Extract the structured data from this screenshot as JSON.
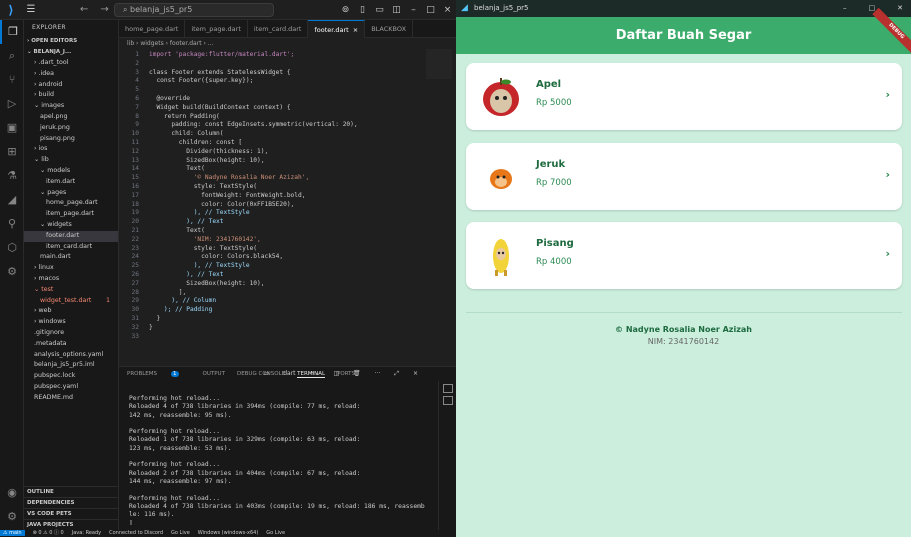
{
  "window": {
    "title": "belanja_js5_pr5"
  },
  "activity": [
    "explorer-icon",
    "search-icon",
    "source-control-icon",
    "run-debug-icon",
    "remote-icon",
    "extensions-icon",
    "testing-icon",
    "flutter-icon",
    "test-icon",
    "deploy-icon",
    "settings-icon"
  ],
  "explorer": {
    "header": "EXPLORER",
    "open_editors": "OPEN EDITORS",
    "project": "BELANJA_J...",
    "items": [
      {
        "label": "› .dart_tool",
        "indent": 1
      },
      {
        "label": "› .idea",
        "indent": 1
      },
      {
        "label": "› android",
        "indent": 1
      },
      {
        "label": "› build",
        "indent": 1
      },
      {
        "label": "⌄ images",
        "indent": 1
      },
      {
        "label": "apel.png",
        "indent": 2
      },
      {
        "label": "jeruk.png",
        "indent": 2
      },
      {
        "label": "pisang.png",
        "indent": 2
      },
      {
        "label": "› ios",
        "indent": 1
      },
      {
        "label": "⌄ lib",
        "indent": 1
      },
      {
        "label": "⌄ models",
        "indent": 2
      },
      {
        "label": "item.dart",
        "indent": 3
      },
      {
        "label": "⌄ pages",
        "indent": 2
      },
      {
        "label": "home_page.dart",
        "indent": 3
      },
      {
        "label": "item_page.dart",
        "indent": 3
      },
      {
        "label": "⌄ widgets",
        "indent": 2
      },
      {
        "label": "footer.dart",
        "indent": 3,
        "selected": true
      },
      {
        "label": "item_card.dart",
        "indent": 3
      },
      {
        "label": "main.dart",
        "indent": 2
      },
      {
        "label": "› linux",
        "indent": 1
      },
      {
        "label": "› macos",
        "indent": 1
      },
      {
        "label": "⌄ test",
        "indent": 1,
        "error": true
      },
      {
        "label": "widget_test.dart",
        "indent": 2,
        "error": true,
        "badge": "1"
      },
      {
        "label": "› web",
        "indent": 1
      },
      {
        "label": "› windows",
        "indent": 1
      },
      {
        "label": ".gitignore",
        "indent": 1
      },
      {
        "label": ".metadata",
        "indent": 1
      },
      {
        "label": "analysis_options.yaml",
        "indent": 1
      },
      {
        "label": "belanja_js5_pr5.iml",
        "indent": 1
      },
      {
        "label": "pubspec.lock",
        "indent": 1
      },
      {
        "label": "pubspec.yaml",
        "indent": 1
      },
      {
        "label": "README.md",
        "indent": 1
      }
    ],
    "bottom_sections": [
      "OUTLINE",
      "DEPENDENCIES",
      "VS CODE PETS",
      "JAVA PROJECTS"
    ]
  },
  "tabs": [
    {
      "label": "home_page.dart"
    },
    {
      "label": "item_page.dart"
    },
    {
      "label": "item_card.dart"
    },
    {
      "label": "footer.dart",
      "active": true,
      "close": "×"
    },
    {
      "label": "BLACKBOX"
    }
  ],
  "breadcrumb": "lib › widgets › footer.dart › ...",
  "code": [
    "import 'package:flutter/material.dart';",
    "",
    "class Footer extends StatelessWidget {",
    "  const Footer({super.key});",
    "",
    "  @override",
    "  Widget build(BuildContext context) {",
    "    return Padding(",
    "      padding: const EdgeInsets.symmetric(vertical: 20),",
    "      child: Column(",
    "        children: const [",
    "          Divider(thickness: 1),",
    "          SizedBox(height: 10),",
    "          Text(",
    "            '© Nadyne Rosalia Noer Azizah',",
    "            style: TextStyle(",
    "              fontWeight: FontWeight.bold,",
    "              color: Color(0xFF1B5E20),",
    "            ), // TextStyle",
    "          ), // Text",
    "          Text(",
    "            'NIM: 2341760142',",
    "            style: TextStyle(",
    "              color: Colors.black54,",
    "            ), // TextStyle",
    "          ), // Text",
    "          SizedBox(height: 10),",
    "        ],",
    "      ), // Column",
    "    ); // Padding",
    "  }",
    "}",
    ""
  ],
  "panel": {
    "tabs": [
      "PROBLEMS",
      "OUTPUT",
      "DEBUG CONSOLE",
      "TERMINAL",
      "PORTS"
    ],
    "problems_count": "1",
    "shell": "dart",
    "terminal": "Performing hot reload...\nReloaded 4 of 738 libraries in 394ms (compile: 77 ms, reload:\n142 ms, reassemble: 95 ms).\n\nPerforming hot reload...\nReloaded 1 of 738 libraries in 329ms (compile: 63 ms, reload:\n123 ms, reassemble: 53 ms).\n\nPerforming hot reload...\nReloaded 2 of 738 libraries in 404ms (compile: 67 ms, reload:\n144 ms, reassemble: 97 ms).\n\nPerforming hot reload...\nReloaded 4 of 738 libraries in 403ms (compile: 19 ms, reload: 186 ms, reassemb\nle: 116 ms).\n▯"
  },
  "status": [
    "⚠ main",
    "⊗ 0 ⚠ 0 ⓘ 0",
    "Java: Ready",
    "Connected to Discord",
    "Go Live",
    "Windows (windows-x64)",
    "Go Live"
  ],
  "app": {
    "window_title": "belanja_js5_pr5",
    "title": "Daftar Buah Segar",
    "debug": "DEBUG",
    "items": [
      {
        "name": "Apel",
        "price": "Rp 5000"
      },
      {
        "name": "Jeruk",
        "price": "Rp 7000"
      },
      {
        "name": "Pisang",
        "price": "Rp 4000"
      }
    ],
    "footer_name": "© Nadyne Rosalia Noer Azizah",
    "footer_nim": "NIM: 2341760142"
  },
  "colors": {
    "appbar": "#3bac6b",
    "background": "#cbeedd",
    "accent": "#0078d4"
  }
}
